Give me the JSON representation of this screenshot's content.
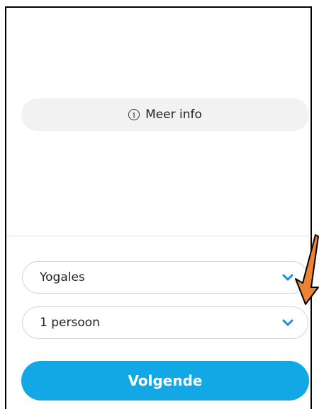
{
  "info_button": {
    "label": "Meer info",
    "icon": "info-circle-icon"
  },
  "selects": [
    {
      "value": "Yogales",
      "icon": "chevron-down-icon"
    },
    {
      "value": "1 persoon",
      "icon": "chevron-down-icon"
    }
  ],
  "next_button": {
    "label": "Volgende"
  },
  "colors": {
    "accent": "#12a8e6",
    "annotation_arrow": "#ee8233",
    "chevron": "#1a8fd6"
  }
}
